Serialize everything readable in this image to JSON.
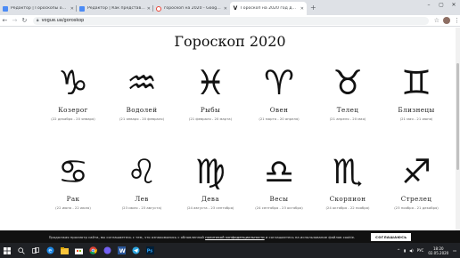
{
  "browser": {
    "tabs": [
      {
        "label": "Редактор | Гороскопы от Сорок",
        "favicon_color": "#4c8bf5",
        "active": false
      },
      {
        "label": "Редактор | Как представили в",
        "favicon_color": "#4c8bf5",
        "active": false
      },
      {
        "label": "гороскоп на 2020 - Google Sea",
        "favicon_color": "#ea4335",
        "active": false
      },
      {
        "label": "Гороскоп на 2020 год для всех",
        "favicon_color": "#111111",
        "active": true
      }
    ],
    "new_tab": "+",
    "window_controls": [
      "–",
      "▢",
      "✕"
    ],
    "url": "vogue.ua/goroskop"
  },
  "page": {
    "title": "Гороскоп 2020",
    "signs": [
      {
        "name": "Козерог",
        "dates": "(22 декабря - 20 января)",
        "icon": "capricorn-icon",
        "glyph": "♑"
      },
      {
        "name": "Водолей",
        "dates": "(21 января - 20 февраля)",
        "icon": "aquarius-icon",
        "glyph": "♒"
      },
      {
        "name": "Рыбы",
        "dates": "(21 февраля - 20 марта)",
        "icon": "pisces-icon",
        "glyph": "♓"
      },
      {
        "name": "Овен",
        "dates": "(21 марта - 20 апреля)",
        "icon": "aries-icon",
        "glyph": "♈"
      },
      {
        "name": "Телец",
        "dates": "(21 апреля - 20 мая)",
        "icon": "taurus-icon",
        "glyph": "♉"
      },
      {
        "name": "Близнецы",
        "dates": "(21 мая - 21 июня)",
        "icon": "gemini-icon",
        "glyph": "♊"
      },
      {
        "name": "Рак",
        "dates": "(22 июня - 22 июля)",
        "icon": "cancer-icon",
        "glyph": "♋"
      },
      {
        "name": "Лев",
        "dates": "(23 июля - 23 августа)",
        "icon": "leo-icon",
        "glyph": "♌"
      },
      {
        "name": "Дева",
        "dates": "(24 августа - 23 сентября)",
        "icon": "virgo-icon",
        "glyph": "♍"
      },
      {
        "name": "Весы",
        "dates": "(24 сентября - 23 октября)",
        "icon": "libra-icon",
        "glyph": "♎"
      },
      {
        "name": "Скорпион",
        "dates": "(24 октября - 22 ноября)",
        "icon": "scorpio-icon",
        "glyph": "♏"
      },
      {
        "name": "Стрелец",
        "dates": "(23 ноября - 21 декабря)",
        "icon": "sagittarius-icon",
        "glyph": "♐"
      }
    ]
  },
  "cookie": {
    "text_before": "Продолжая просмотр сайта, вы соглашаетесь с тем, что ознакомились с обновленной ",
    "link": "политикой конфиденциальности",
    "text_after": " и соглашаетесь на использование файлов cookie.",
    "button": "СОГЛАШАЮСЬ"
  },
  "taskbar": {
    "lang": "РУС",
    "time": "18:20",
    "date": "02.05.2020"
  },
  "colors": {
    "tabstrip": "#dee1e6",
    "cookie_bg": "#111111",
    "taskbar_bg": "#1f2125"
  }
}
